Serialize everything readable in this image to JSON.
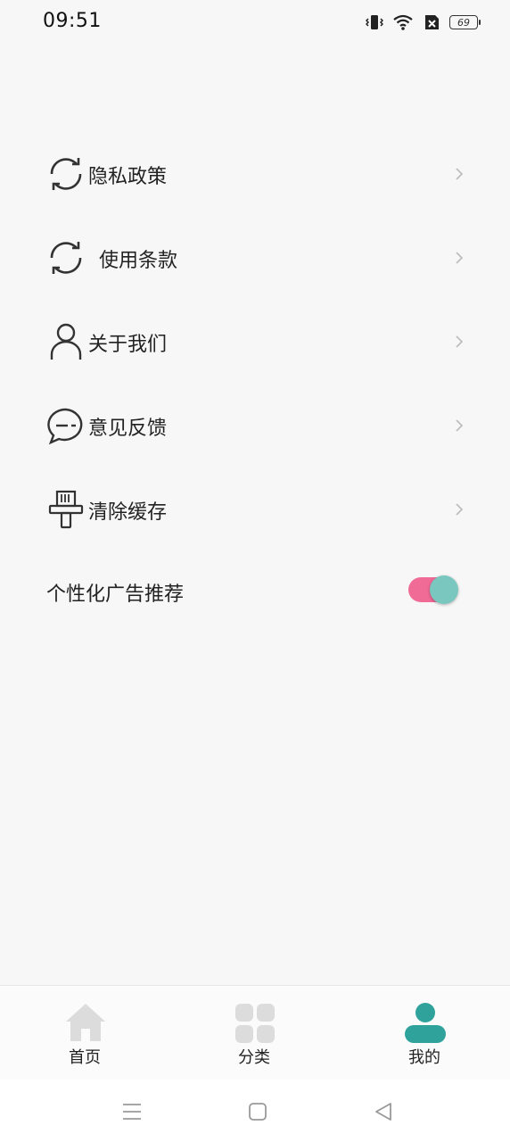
{
  "status_bar": {
    "time": "09:51",
    "battery_level": "69",
    "icons": [
      "vibrate-icon",
      "wifi-icon",
      "no-sim-icon",
      "battery-icon"
    ]
  },
  "menu": {
    "items": [
      {
        "label": "隐私政策",
        "icon": "refresh-circle-icon"
      },
      {
        "label": "使用条款",
        "icon": "refresh-circle-icon"
      },
      {
        "label": "关于我们",
        "icon": "person-icon"
      },
      {
        "label": "意见反馈",
        "icon": "chat-bubble-icon"
      },
      {
        "label": "清除缓存",
        "icon": "broom-icon"
      }
    ],
    "toggle": {
      "label": "个性化广告推荐",
      "enabled": true,
      "track_color": "#f06b96",
      "knob_color": "#79c7bf"
    }
  },
  "tab_bar": {
    "tabs": [
      {
        "label": "首页",
        "icon": "home-icon",
        "active": false
      },
      {
        "label": "分类",
        "icon": "grid-icon",
        "active": false
      },
      {
        "label": "我的",
        "icon": "profile-icon",
        "active": true
      }
    ],
    "active_color": "#2fa39b",
    "inactive_color": "#dcdcdc"
  },
  "nav_bar": {
    "buttons": [
      "menu-icon",
      "home-square-icon",
      "back-triangle-icon"
    ]
  }
}
